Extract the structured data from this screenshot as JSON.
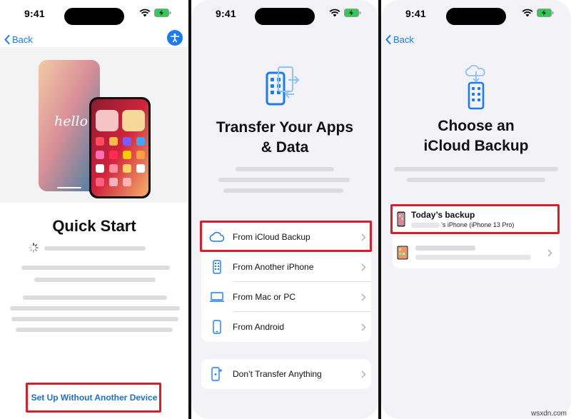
{
  "status": {
    "time": "9:41"
  },
  "nav": {
    "back_label": "Back"
  },
  "screen1": {
    "title": "Quick Start",
    "hello_text": "hello",
    "setup_link": "Set Up Without Another Device"
  },
  "screen2": {
    "title_line1": "Transfer Your Apps",
    "title_line2": "& Data",
    "options": [
      {
        "label": "From iCloud Backup",
        "icon": "cloud-icon"
      },
      {
        "label": "From Another iPhone",
        "icon": "iphone-icon"
      },
      {
        "label": "From Mac or PC",
        "icon": "laptop-icon"
      },
      {
        "label": "From Android",
        "icon": "android-phone-icon"
      }
    ],
    "dont_transfer": "Don’t Transfer Anything"
  },
  "screen3": {
    "title_line1": "Choose an",
    "title_line2": "iCloud Backup",
    "backup_title": "Today’s backup",
    "backup_sub": "’s iPhone (iPhone 13 Pro)"
  },
  "watermark": "wsxdn.com",
  "colors": {
    "accent": "#1a7cf5",
    "highlight": "#d81e2c",
    "link": "#1a6fe0"
  }
}
